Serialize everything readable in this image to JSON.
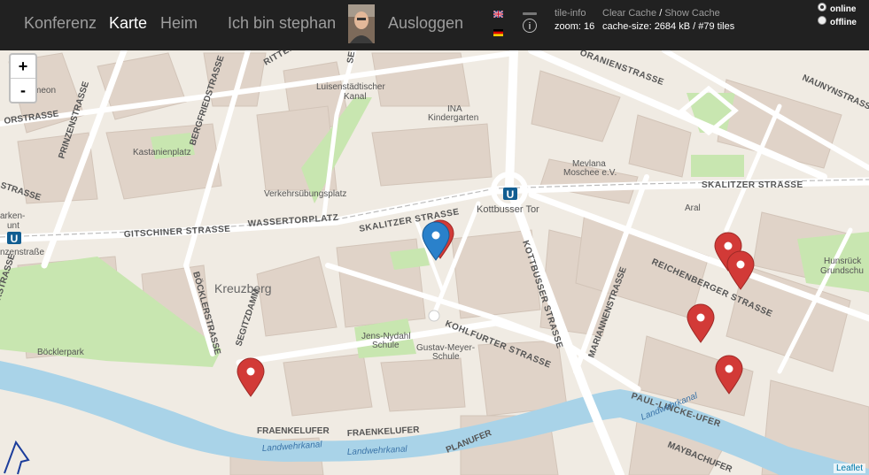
{
  "nav": {
    "konferenz": "Konferenz",
    "karte": "Karte",
    "heim": "Heim",
    "user": "Ich bin stephan",
    "logout": "Ausloggen"
  },
  "tile": {
    "title": "tile-info",
    "zoom_text": "zoom: 16",
    "clear_cache": "Clear Cache",
    "separator": "/",
    "show_cache": "Show Cache",
    "cache_size_text": "cache-size: 2684 kB / #79 tiles"
  },
  "mode": {
    "online_label": "online",
    "offline_label": "offline",
    "selected": "online"
  },
  "map": {
    "zoom_in": "+",
    "zoom_out": "-",
    "attribution": "Leaflet",
    "labels": {
      "ritterstrasse": "RITTERSTRASSE",
      "luisenstadt": "Luisenstädtischer",
      "kanal": "Kanal",
      "ina": "INA",
      "kindergarten": "Kindergarten",
      "oranienstrasse": "ORANIENSTRASSE",
      "naunynstrasse": "NAUNYNSTRASSE",
      "prinzenstrasse": "PRINZENSTRASSE",
      "bergfriedstrasse": "BERGFRIEDSTRASSE",
      "kastanienplatz": "Kastanienplatz",
      "mevlana": "Mevlana",
      "moschee": "Moschee e.V.",
      "skalitzer_east": "SKALITZER STRASSE",
      "verkehrs": "Verkehrsübungsplatz",
      "gitschiner": "GITSCHINER STRASSE",
      "wassertorplatz": "WASSERTORPLATZ",
      "skalitzer_west": "SKALITZER STRASSE",
      "kottbusser_tor": "Kottbusser Tor",
      "aral": "Aral",
      "reichenberger": "REICHENBERGER STRASSE",
      "hunsrueck": "Hunsrück",
      "grundschule": "Grundschu",
      "kreuzberg": "Kreuzberg",
      "boecklerstrasse": "BÖCKLERSTRASSE",
      "segitzdamm": "SEGITZDAMM",
      "kottbusser_strasse": "KOTTBUSSER STRASSE",
      "mariannenstrasse": "MARIANNENSTRASSE",
      "kohlfurter": "KOHLFURTER STRASSE",
      "jens_nydahl": "Jens-Nydahl",
      "schule1": "Schule",
      "gustav_meyer": "Gustav-Meyer-",
      "schule2": "Schule",
      "boecklerpark": "Böcklerpark",
      "paul_lincke": "PAUL-LINCKE-UFER",
      "fraenkelufer1": "FRAENKELUFER",
      "fraenkelufer2": "FRAENKELUFER",
      "planufer": "PLANUFER",
      "landwehrkanal1": "Landwehrkanal",
      "landwehrkanal2": "Landwehrkanal",
      "landwehrkanal3": "Landwehrkanal",
      "maybachufer": "MAYBACHUFER",
      "ubahn": "U",
      "left_arken": "arken-",
      "left_unt": "unt",
      "left_nzenstr": "nzenstraße",
      "left_rstr": "RSTRASSE",
      "left_strasse": "STRASSE",
      "left_meon": "meon",
      "left_orstr": "ORSTRASSE",
      "se_cut": "SE"
    }
  },
  "colors": {
    "topbar": "#212121",
    "marker_red": "#d23a37",
    "marker_blue": "#2a81cb",
    "water": "#a9d3e8",
    "park": "#c8e6b0"
  }
}
